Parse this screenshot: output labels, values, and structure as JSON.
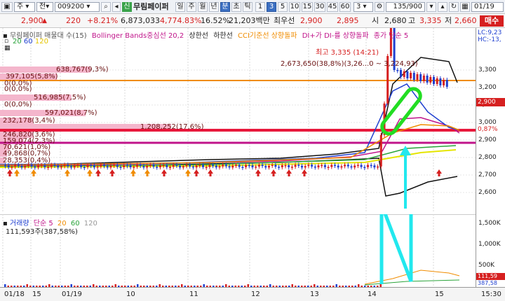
{
  "toolbar": {
    "icon_label": "",
    "mode_select": "주",
    "market_select": "전",
    "code": "009200",
    "stock_badge": "신",
    "stock_name": "무림페이퍼",
    "period_buttons": [
      "일",
      "주",
      "월",
      "년",
      "분",
      "초",
      "틱"
    ],
    "active_period": "분",
    "intervals": [
      "1",
      "3",
      "5",
      "10",
      "15",
      "30",
      "45",
      "60"
    ],
    "interval_value": "3",
    "count": "135/900",
    "date_label": "01/19"
  },
  "quote": {
    "price": "2,900",
    "change": "220",
    "change_pct": "+8.21%",
    "volume": "6,873,033",
    "volume_ratio": "4,774.83%",
    "turnover": "16.52%",
    "amount": "21,203백만",
    "seller_label": "최우선",
    "ask": "2,900",
    "bid": "2,895",
    "open_label": "시",
    "open": "2,680",
    "high_label": "고",
    "high": "3,335",
    "low_label": "저",
    "low": "2,660",
    "buy_button": "매수"
  },
  "price_panel": {
    "legend_items": [
      {
        "text": "무림페이퍼 매물대 수(15)",
        "color": "#555555"
      },
      {
        "text": "Bollinger Bands중심선 20,2",
        "color": "#c0148a"
      },
      {
        "text": "상한선",
        "color": "#222222"
      },
      {
        "text": "하한선",
        "color": "#222222"
      },
      {
        "text": "CCI기준선 상향돌파",
        "color": "#f08c00"
      },
      {
        "text": "DI+가 DI-를 상향돌파",
        "color": "#c0148a"
      },
      {
        "text": "종가 단순 5",
        "color": "#c0148a"
      }
    ],
    "ma_legend": [
      "20",
      "60",
      "120"
    ],
    "right_legend": [
      "LC:9,23",
      "HC:-13,"
    ],
    "high_annotation": "최고 3,335 (14:21)",
    "range_annotation": "2,673,650(38,8%)(3,26...0 ~ 3,224,93)",
    "volume_profile": [
      {
        "label": "638,767(9,3%)",
        "width_pct": 0.19
      },
      {
        "label": "397,105(5,8%)",
        "width_pct": 0.12
      },
      {
        "label": "0(0,0%)",
        "width_pct": 0.0
      },
      {
        "label": "0(0,0%)",
        "width_pct": 0.0
      },
      {
        "label": "516,985(7,5%)",
        "width_pct": 0.15
      },
      {
        "label": "0(0,0%)",
        "width_pct": 0.0
      },
      {
        "label": "597,021(8,7%)",
        "width_pct": 0.18
      },
      {
        "label": "232,178(3,4%)",
        "width_pct": 0.07
      },
      {
        "label": "1,208,252(17,6%)",
        "width_pct": 0.36
      },
      {
        "label": "246,820(3,6%)",
        "width_pct": 0.07
      },
      {
        "label": "159,074(2,3%)",
        "width_pct": 0.05
      },
      {
        "label": "70,621(1,0%)",
        "width_pct": 0.02
      },
      {
        "label": "49,868(0,7%)",
        "width_pct": 0.015
      },
      {
        "label": "28,353(0,4%)",
        "width_pct": 0.01
      }
    ],
    "y_ticks": [
      "3,300",
      "3,200",
      "3,100",
      "3,000",
      "2,900",
      "2,800",
      "2,700",
      "2,600"
    ],
    "current_price_tag": "2,900",
    "current_pct_tag": "0,87%"
  },
  "volume_panel": {
    "legend": [
      "거래량",
      "단순",
      "5",
      "20",
      "60",
      "120"
    ],
    "value": "111,593주(387,58%)",
    "y_ticks": [
      "1,500K",
      "1,000K",
      "500K"
    ],
    "current_tag": "111,59",
    "current_pct_tag": "387,58"
  },
  "time_axis": [
    "01/18",
    "15",
    "01/19",
    "10",
    "11",
    "12",
    "13",
    "14",
    "15"
  ],
  "time_axis_right": "15:30",
  "colors": {
    "up": "#d62020",
    "down": "#1f3fd0",
    "profile": "#f4b6cc",
    "orange_line": "#f08c00",
    "red_line": "#e8183c",
    "magenta_line": "#c0148a",
    "annotation_green": "#22dd22",
    "annotation_cyan": "#22e8ee"
  }
}
